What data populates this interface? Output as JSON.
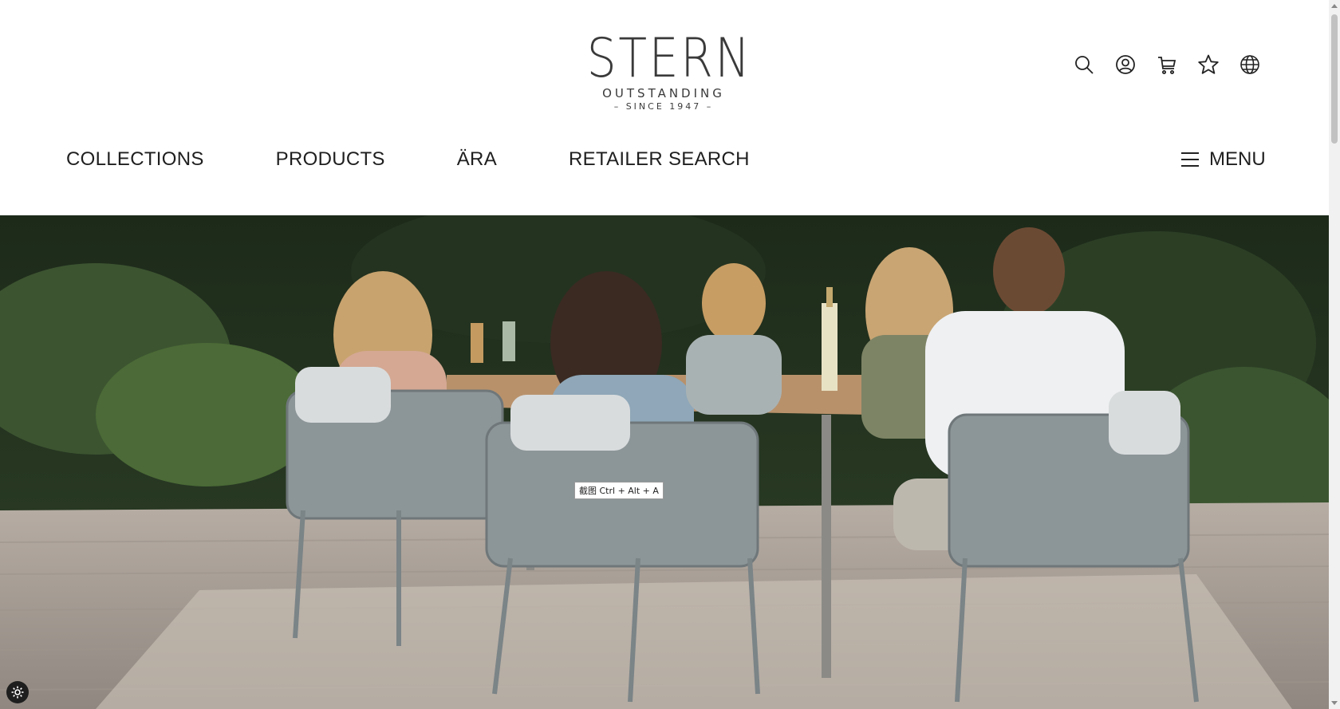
{
  "logo": {
    "main": "STERN",
    "tagline": "OUTSTANDING",
    "since": "– SINCE 1947 –"
  },
  "header_icons": [
    {
      "name": "search-icon"
    },
    {
      "name": "account-icon"
    },
    {
      "name": "cart-icon"
    },
    {
      "name": "favorites-star-icon"
    },
    {
      "name": "language-globe-icon"
    }
  ],
  "nav": {
    "items": [
      {
        "label": "COLLECTIONS"
      },
      {
        "label": "PRODUCTS"
      },
      {
        "label": "ÄRA"
      },
      {
        "label": "RETAILER SEARCH"
      }
    ],
    "menu_label": "MENU"
  },
  "hero": {
    "tooltip": "截图 Ctrl + Alt + A"
  },
  "colors": {
    "text": "#1f1f1f",
    "logo": "#3a3a3a",
    "background": "#ffffff"
  }
}
